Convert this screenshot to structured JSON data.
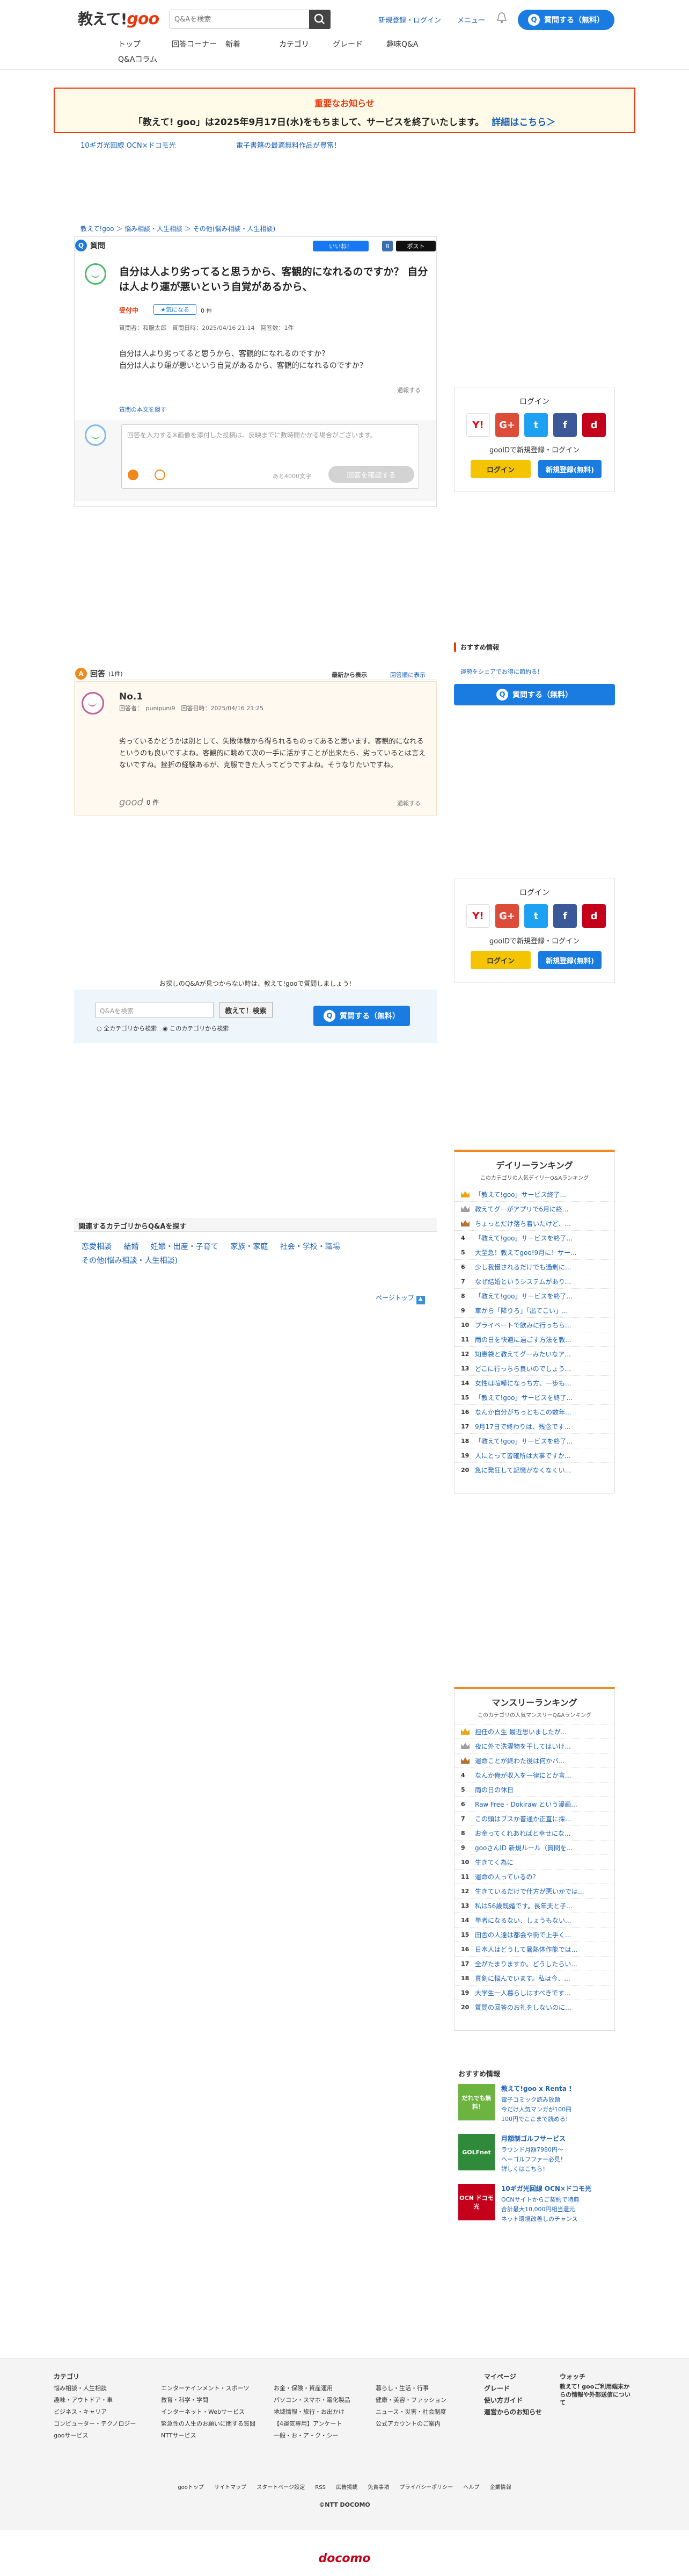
{
  "header": {
    "logo_text": "教えて!",
    "logo_goo": "goo",
    "search_placeholder": "Q&Aを検索",
    "register_login": "新規登録・ログイン",
    "menu": "メニュー",
    "ask_button": "質問する（無料）"
  },
  "nav": {
    "items": [
      "トップ",
      "回答コーナー",
      "新着",
      "カテゴリ",
      "グレード",
      "趣味Q&A"
    ],
    "second": "Q&Aコラム"
  },
  "notice": {
    "title": "重要なお知らせ",
    "message": "「教えて! goo」は2025年9月17日(水)をもちまして、サービスを終了いたします。",
    "link": "詳細はこちら＞"
  },
  "promos": [
    "10ギガ光回線 OCN×ドコモ光",
    "電子書籍の最適無料作品が豊富！"
  ],
  "breadcrumb": "教えて!goo ＞ 悩み相談・人生相談 ＞ その他(悩み相談・人生相談)",
  "question": {
    "section_label": "質問",
    "like_button": "いいね！",
    "post_button": "ポスト",
    "title": "自分は人より劣ってると思うから、客観的になれるのですか？ 自分は人より運が悪いという自覚があるから、",
    "status": "受付中",
    "fav_label": "気になる",
    "fav_count": "0 件",
    "meta": "質問者：和服太郎　質問日時：2025/04/16 21:14　回答数：1件",
    "body_line1": "自分は人より劣ってると思うから、客観的になれるのですか？",
    "body_line2": "自分は人より運が悪いという自覚があるから、客観的になれるのですか？",
    "report": "通報する",
    "full_text_link": "質問の本文を隠す",
    "reply_placeholder": "回答を入力する※画像を添付した投稿は、反映までに数時間かかる場合がございます。",
    "char_limit": "あと4000文字",
    "reply_button": "回答を確認する"
  },
  "login_box": {
    "title": "ログイン",
    "subtitle": "gooIDで新規登録・ログイン",
    "login_button": "ログイン",
    "register_button": "新規登録(無料)"
  },
  "answers": {
    "section_label": "回答",
    "count": "(1件)",
    "sort_new": "最新から表示",
    "sort_old": "回答順に表示",
    "items": [
      {
        "no": "No.1",
        "meta": "回答者：　punipuni9　回答日時：2025/04/16 21:25",
        "body": "劣っているかどうかは別として、失敗体験から得られるものってあると思います。客観的になれるというのも良いですよね。客観的に眺めて次の一手に活かすことが出来たら、劣っているとは言えないですね。挫折の経験あるが、克服できた人ってどうですよね。そうなりたいですね。",
        "good_label": "good",
        "good_count": "0 件",
        "report": "通報する"
      }
    ]
  },
  "recommend": {
    "title": "おすすめ情報",
    "link": "運勢をシェアでお得に節約る！",
    "ask_button": "質問する（無料）"
  },
  "bottom_search": {
    "label": "お探しのQ&Aが見つからない時は、教えて!gooで質問しましょう!",
    "placeholder": "Q&Aを検索",
    "search_button": "教えて！検索",
    "radio_all": "全カテゴリから検索",
    "radio_this": "このカテゴリから検索",
    "ask_button": "質問する（無料）"
  },
  "related": {
    "title": "関連するカテゴリからQ&Aを探す",
    "links": [
      "恋愛相談",
      "結婚",
      "妊娠・出産・子育て",
      "家族・家庭",
      "社会・学校・職場"
    ],
    "links2": [
      "その他(悩み相談・人生相談)"
    ],
    "page_top": "ページトップ"
  },
  "daily_ranking": {
    "title": "デイリーランキング",
    "subtitle": "このカテゴリの人気デイリーQ&Aランキング",
    "items": [
      "「教えて!goo」サービス終了...",
      "教えてグーがアプリで6月に終...",
      "ちょっとだけ落ち着いたけど、...",
      "「教えて!goo」サービスを終了...",
      "大至急！教えてgoo!9月に！サー...",
      "少し我慢されるだけでも過剰に...",
      "なぜ結婚というシステムがあり...",
      "「教えて!goo」サービスを終了...",
      "車から「降りろ」「出てこい」...",
      "プライベートで飲みに行っちら...",
      "雨の日を快適に過ごす方法を教...",
      "知恵袋と教えてグーみたいなア...",
      "どこに行っちら良いのでしょう...",
      "女性は喧嘩になっち方、一歩も...",
      "「教えて!goo」サービスを終了...",
      "なんか自分がちっともこの数年...",
      "9月17日で終わりは、残念です...",
      "「教えて!goo」サービスを終了...",
      "人にとって皆確所は大事ですか...",
      "急に発狂して記憶がなくなくい..."
    ]
  },
  "monthly_ranking": {
    "title": "マンスリーランキング",
    "subtitle": "このカテゴリの人気マンスリーQ&Aランキング",
    "items": [
      "担任の人生 最近思いましたが...",
      "夜に外で洗濯物を干してはいけ...",
      "運命ことが終わた後は何かバ...",
      "なんか俺が収入を一律にとか言...",
      "雨の日の休日",
      "Raw Free - Dokiraw という漫画...",
      "この頭はブスか普通か正直に採...",
      "お金ってくれあればと幸せにな...",
      "gooさんID 新規ルール（質問を...",
      "生きてく為に",
      "運命の人っているの？",
      "生きているだけで仕方が悪いかでは...",
      "私は56歳既婚です。長年夫と子...",
      "単者になるない、しょうもない...",
      "田舎の人達は都会や街で上手く...",
      "日本人はどうして暑熱体作能では...",
      "全がたまりますか。どうしたらい...",
      "真剣に悩んでいます。私は今、...",
      "大学生一人暮らしはすべきです...",
      "質問の回答のお礼をしないのに..."
    ]
  },
  "recommended_info": {
    "title": "おすすめ情報",
    "items": [
      {
        "image_text": "だれでも無料!",
        "image_color": "#6cb33f",
        "title": "教えて!goo x Renta !",
        "lines": [
          "電子コミック読み放題",
          "今だけ人気マンガが100冊",
          "100円でここまで読める!"
        ]
      },
      {
        "image_text": "GOLFnet",
        "image_color": "#2f8a3a",
        "title": "月額制ゴルフサービス",
        "lines": [
          "ラウンド月額7980円～",
          "ヘーゴルフファー必見！",
          "詳しくはこちら！"
        ]
      },
      {
        "image_text": "OCN ドコモ光",
        "image_color": "#c4001a",
        "title": "10ギガ光回線 OCN×ドコモ光",
        "lines": [
          "OCNサイトからご契約で特典",
          "合計最大10,000円相当還元",
          "ネット環境改善しのチャンス"
        ]
      }
    ]
  },
  "footer": {
    "category_title": "カテゴリ",
    "col1": [
      "悩み相談・人生相談",
      "趣味・アウトドア・車",
      "ビジネス・キャリア",
      "コンピューター・テクノロジー",
      "gooサービス"
    ],
    "col2": [
      "エンターテインメント・スポーツ",
      "教育・科学・学問",
      "インターネット・Webサービス",
      "緊急性の人生のお願いに関する質問",
      "NTTサービス"
    ],
    "col3": [
      "お金・保険・資産運用",
      "パソコン・スマホ・電化製品",
      "地域情報・旅行・お出かけ",
      "【4運気専用】アンケート",
      "一般・お・ア・ク・シー"
    ],
    "col4": [
      "暮らし・生活・行事",
      "健康・美容・ファッション",
      "ニュース・災害・社会制度",
      "公式アカウントのご案内"
    ],
    "col5": [
      "マイページ",
      "グレード",
      "使い方ガイド",
      "運営からのお知らせ"
    ],
    "col6_title": "ウォッチ",
    "col6": [
      "教えて! gooご利用端末からの情報や外部送信について"
    ],
    "links": [
      "gooトップ",
      "サイトマップ",
      "スタートページ設定",
      "RSS",
      "広告掲載",
      "免責事項",
      "プライバシーポリシー",
      "ヘルプ",
      "企業情報"
    ],
    "copyright": "©NTT DOCOMO",
    "brand": "docomo"
  }
}
